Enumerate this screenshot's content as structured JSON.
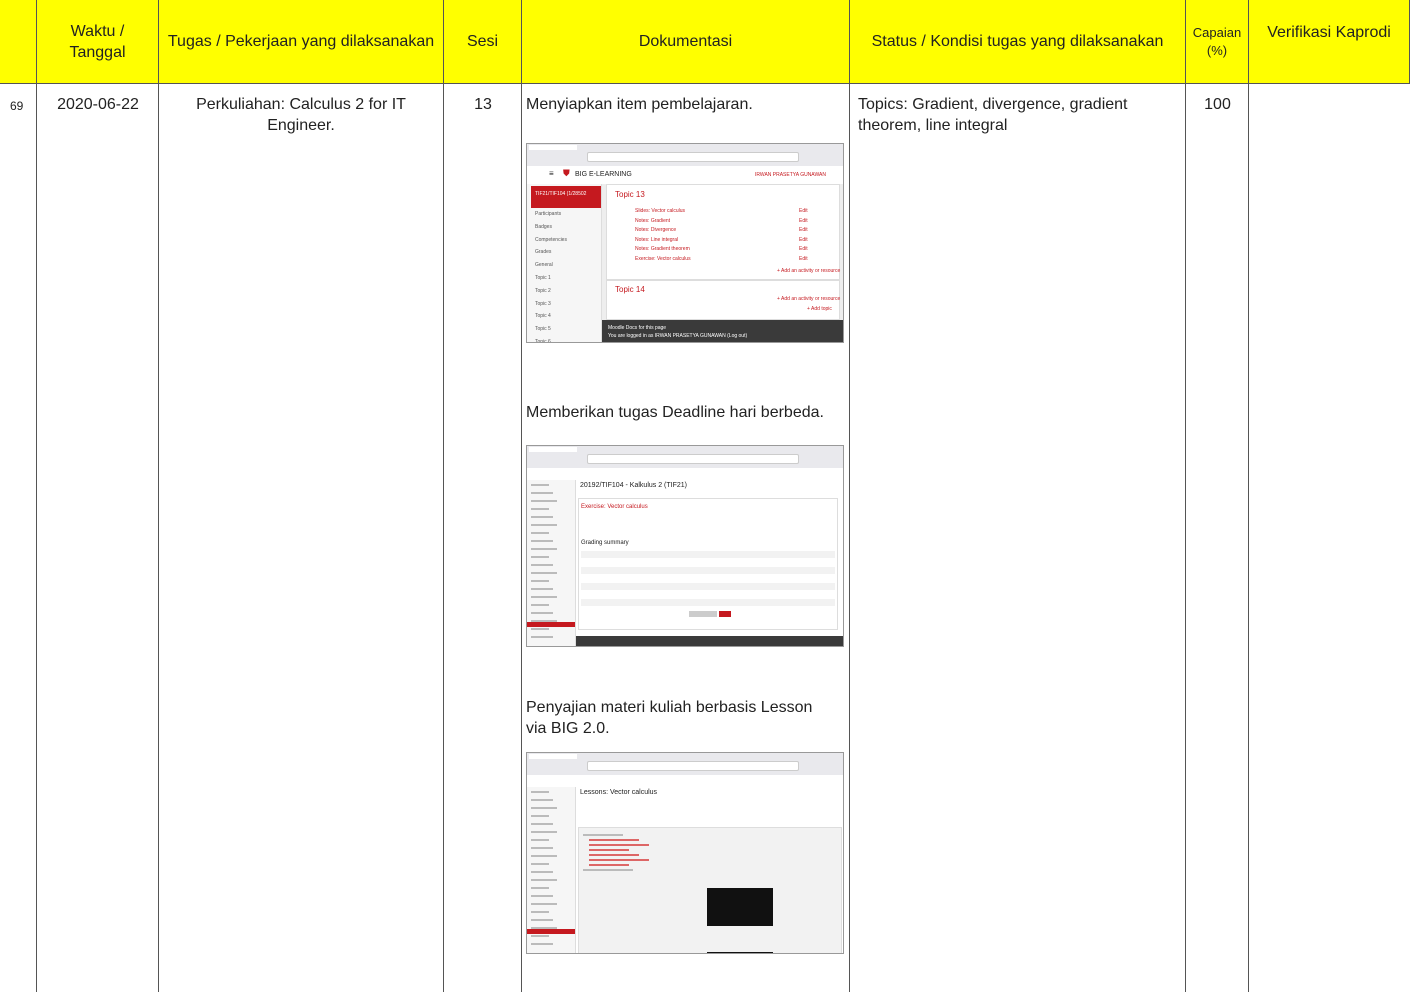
{
  "headers": {
    "no": "",
    "waktu": "Waktu / Tanggal",
    "tugas": "Tugas / Pekerjaan yang dilaksanakan",
    "sesi": "Sesi",
    "dokumentasi": "Dokumentasi",
    "status": "Status / Kondisi tugas yang dilaksanakan",
    "capaian": "Capaian (%)",
    "verifikasi": "Verifikasi Kaprodi"
  },
  "row": {
    "no": "69",
    "tanggal": "2020-06-22",
    "tugas": "Perkuliahan: Calculus 2 for IT Engineer.",
    "sesi": "13",
    "status": "Topics: Gradient, divergence, gradient theorem, line integral",
    "capaian": "100",
    "verifikasi": ""
  },
  "documentation": [
    {
      "caption": "Menyiapkan item pembelajaran.",
      "screenshot": {
        "site": "BIG E-LEARNING",
        "course": "TIF21/TIF104 (1/28502",
        "user": "IRWAN PRASETYA GUNAWAN",
        "topic_title": "Topic 13",
        "items": [
          "Slides: Vector calculus",
          "Notes: Gradient",
          "Notes: Divergence",
          "Notes: Line integral",
          "Notes: Gradient theorem",
          "Exercise: Vector calculus"
        ],
        "edit": "Edit",
        "add_activity": "+ Add an activity or resource",
        "topic_next": "Topic 14",
        "add_topic": "+ Add topic",
        "footer_link": "Moodle Docs for this page",
        "footer_login": "You are logged in as IRWAN PRASETYA GUNAWAN (Log out)",
        "side_items": [
          "Participants",
          "Badges",
          "Competencies",
          "Grades",
          "General",
          "Topic 1",
          "Topic 2",
          "Topic 3",
          "Topic 4",
          "Topic 5",
          "Topic 6"
        ]
      }
    },
    {
      "caption": "Memberikan tugas Deadline hari berbeda.",
      "screenshot": {
        "page_title": "20192/TIF104 - Kalkulus 2 (TIF21)",
        "assignment": "Exercise: Vector calculus",
        "section": "Grading summary"
      }
    },
    {
      "caption": "Penyajian materi kuliah berbasis Lesson via BIG 2.0.",
      "screenshot": {
        "page_title": "Lessons: Vector calculus"
      }
    }
  ]
}
